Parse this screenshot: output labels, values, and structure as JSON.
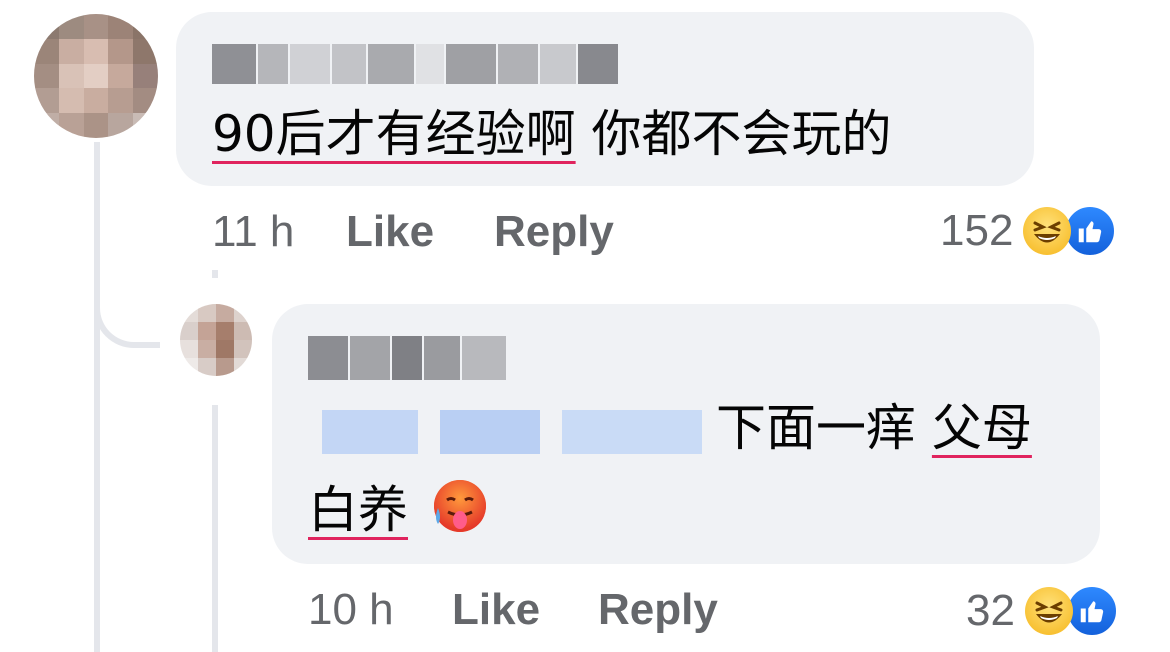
{
  "comment1": {
    "author": "",
    "text_underlined": "90后才有经验啊",
    "text_rest": " 你都不会玩的",
    "time": "11 h",
    "like_label": "Like",
    "reply_label": "Reply",
    "reaction_count": "152"
  },
  "reply1": {
    "author": "",
    "mention": "",
    "text_a": "下面一痒 ",
    "text_a_underlined": "父母",
    "text_b_underlined": "白养",
    "time": "10 h",
    "like_label": "Like",
    "reply_label": "Reply",
    "reaction_count": "32"
  },
  "reactions": [
    "laugh-icon",
    "like-icon"
  ],
  "colors": {
    "bubble": "#f0f2f5",
    "meta": "#65676b",
    "underline": "#e0245e",
    "like": "#1877f2",
    "mention": "#c7daf7"
  }
}
